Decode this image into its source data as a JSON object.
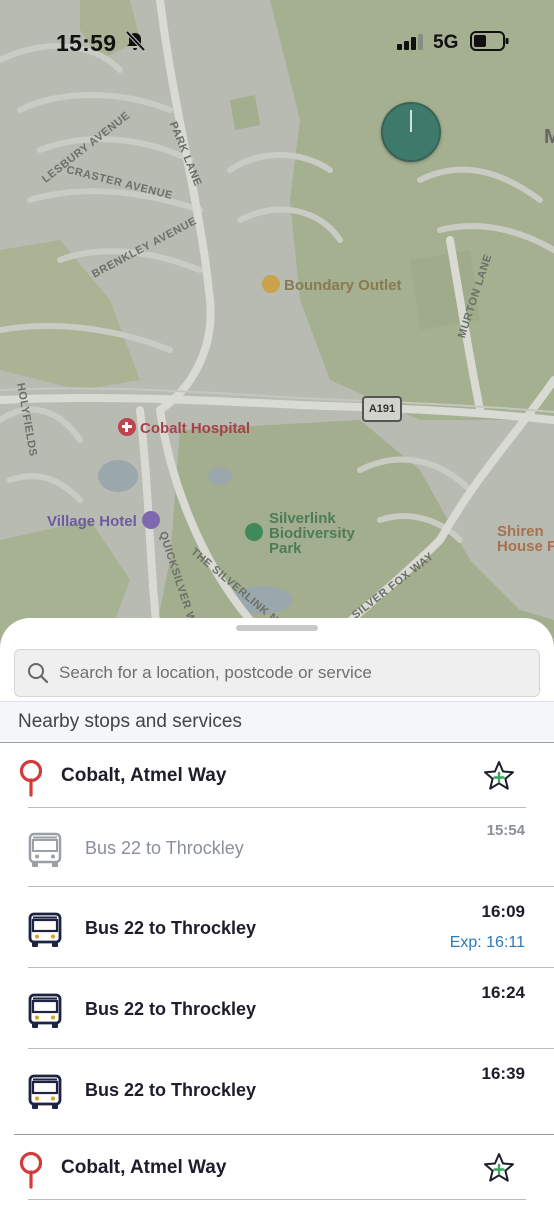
{
  "status_bar": {
    "time": "15:59",
    "network": "5G"
  },
  "map": {
    "streets": [
      "LESBURY AVENUE",
      "CRASTER AVENUE",
      "PARK LANE",
      "BRENKLEY AVENUE",
      "MURTON LANE",
      "HOLYFIELDS",
      "QUICKSILVER W",
      "THE SILVERLINK N",
      "SILVER FOX WAY"
    ],
    "road_shield": "A191",
    "pois": {
      "boundary_outlet": "Boundary Outlet",
      "hospital": "Cobalt Hospital",
      "hotel": "Village Hotel",
      "park_line1": "Silverlink",
      "park_line2": "Biodiversity",
      "park_line3": "Park",
      "shire_line1": "Shiren",
      "shire_line2": "House F",
      "edge_letter": "M"
    },
    "colors": {
      "hospital": "#c0444e",
      "hotel": "#7e68b0",
      "park": "#3f8a5a",
      "outlet": "#c9a24a",
      "shire": "#b87756"
    }
  },
  "sheet": {
    "search_placeholder": "Search for a location, postcode or service",
    "section_title": "Nearby stops and services",
    "stops": [
      {
        "name": "Cobalt, Atmel Way",
        "services": [
          {
            "label": "Bus 22 to Throckley",
            "time": "15:54",
            "expected": "",
            "past": true
          },
          {
            "label": "Bus 22 to Throckley",
            "time": "16:09",
            "expected": "Exp: 16:11",
            "past": false
          },
          {
            "label": "Bus 22 to Throckley",
            "time": "16:24",
            "expected": "",
            "past": false
          },
          {
            "label": "Bus 22 to Throckley",
            "time": "16:39",
            "expected": "",
            "past": false
          }
        ]
      },
      {
        "name": "Cobalt, Atmel Way",
        "services": []
      }
    ]
  },
  "icons": [
    "bell-slash-icon",
    "signal-icon",
    "battery-icon",
    "search-icon",
    "stop-pin-icon",
    "favourite-add-icon",
    "bus-icon",
    "user-location-icon"
  ]
}
